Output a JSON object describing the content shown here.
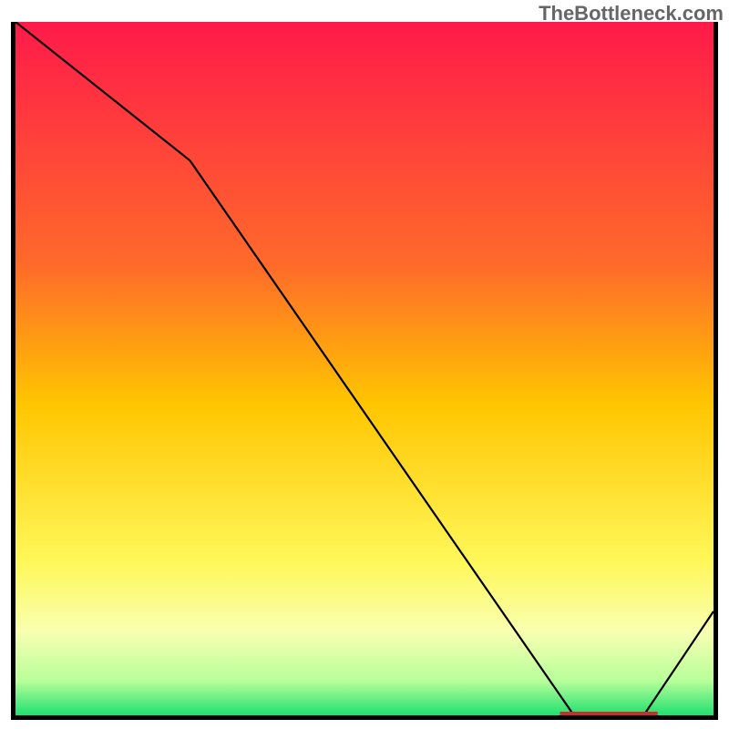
{
  "watermark": "TheBottleneck.com",
  "marker": {
    "label": ""
  },
  "chart_data": {
    "type": "line",
    "title": "",
    "xlabel": "",
    "ylabel": "",
    "xlim": [
      0,
      100
    ],
    "ylim": [
      0,
      100
    ],
    "x": [
      0,
      25,
      80,
      90,
      100
    ],
    "values": [
      100,
      80,
      0,
      0,
      15
    ],
    "gradient_stops": [
      {
        "offset": 0,
        "color": "#ff1a4a"
      },
      {
        "offset": 0.35,
        "color": "#ff6a2a"
      },
      {
        "offset": 0.55,
        "color": "#ffc500"
      },
      {
        "offset": 0.78,
        "color": "#fff85a"
      },
      {
        "offset": 0.88,
        "color": "#f8ffb0"
      },
      {
        "offset": 0.95,
        "color": "#b8ff9a"
      },
      {
        "offset": 1,
        "color": "#20e070"
      }
    ],
    "marker_band": {
      "x_start": 78,
      "x_end": 92,
      "y": 0
    }
  }
}
